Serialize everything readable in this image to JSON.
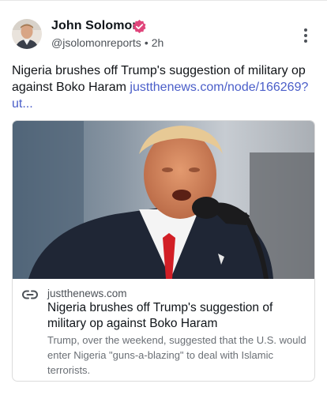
{
  "author": {
    "name": "John Solomon",
    "handle": "@jsolomonreports",
    "separator": "•",
    "time": "2h",
    "verified_color": "#e0457b"
  },
  "post": {
    "text": "Nigeria brushes off Trump's suggestion of military op against Boko Haram",
    "link_text": "justthenews.com/node/166269?ut..."
  },
  "card": {
    "domain": "justthenews.com",
    "title": "Nigeria brushes off Trump's suggestion of military op against Boko Haram",
    "description": "Trump, over the weekend, suggested that the U.S. would enter Nigeria \"guns-a-blazing\" to deal with Islamic terrorists."
  },
  "icons": {
    "verified": "verified-badge-icon",
    "more": "more-vertical-icon",
    "link": "link-icon"
  },
  "colors": {
    "link": "#4a5ec9",
    "text": "#0f1419",
    "muted": "#4d5258"
  }
}
